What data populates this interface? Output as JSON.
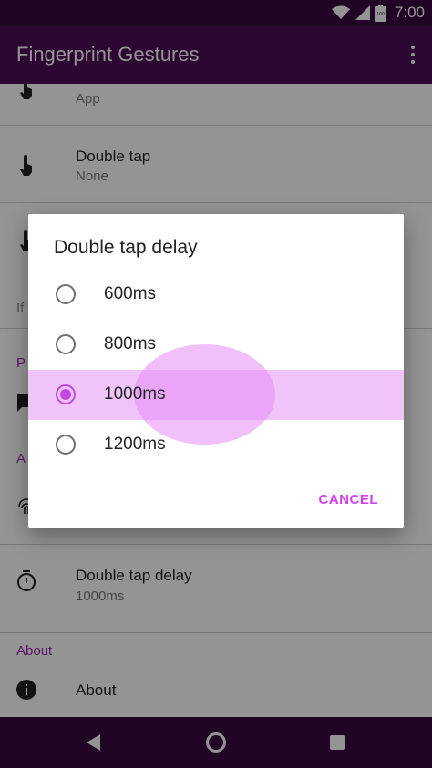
{
  "status_bar": {
    "time": "7:00",
    "icons": [
      "wifi-icon",
      "signal-icon",
      "battery-icon"
    ],
    "battery_text": "100"
  },
  "app_bar": {
    "title": "Fingerprint Gestures",
    "overflow_icon": "more-vert-icon"
  },
  "settings": {
    "partial_row": {
      "subtitle": "App",
      "icon": "touch-icon"
    },
    "double_tap": {
      "title": "Double tap",
      "subtitle": "None",
      "icon": "touch-icon"
    },
    "fragment_if": "If",
    "fragment_p": "P",
    "fragment_a": "A",
    "double_tap_delay": {
      "title": "Double tap delay",
      "subtitle": "1000ms",
      "icon": "timer-icon"
    },
    "about_category": "About",
    "about": {
      "title": "About",
      "icon": "info-icon"
    }
  },
  "dialog": {
    "title": "Double tap delay",
    "options": [
      {
        "label": "600ms",
        "selected": false
      },
      {
        "label": "800ms",
        "selected": false
      },
      {
        "label": "1000ms",
        "selected": true
      },
      {
        "label": "1200ms",
        "selected": false
      }
    ],
    "cancel_label": "CANCEL"
  },
  "nav_bar": {
    "icons": [
      "back-icon",
      "home-icon",
      "recents-icon"
    ]
  },
  "colors": {
    "status_bar": "#3a0a40",
    "app_bar": "#4d0d56",
    "accent": "#c447e0",
    "selected_row": "#f0c3fa",
    "category_text": "#9c27b0"
  }
}
